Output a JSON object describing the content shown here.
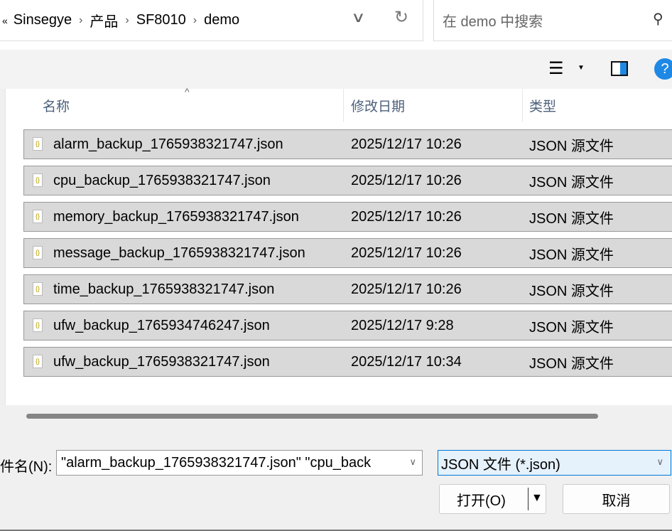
{
  "breadcrumb": {
    "overflow": "«",
    "items": [
      "Sinsegye",
      "产品",
      "SF8010",
      "demo"
    ]
  },
  "search": {
    "placeholder": "在 demo 中搜索"
  },
  "columns": {
    "name": "名称",
    "date": "修改日期",
    "type": "类型"
  },
  "files": [
    {
      "name": "alarm_backup_1765938321747.json",
      "date": "2025/12/17 10:26",
      "type": "JSON 源文件"
    },
    {
      "name": "cpu_backup_1765938321747.json",
      "date": "2025/12/17 10:26",
      "type": "JSON 源文件"
    },
    {
      "name": "memory_backup_1765938321747.json",
      "date": "2025/12/17 10:26",
      "type": "JSON 源文件"
    },
    {
      "name": "message_backup_1765938321747.json",
      "date": "2025/12/17 10:26",
      "type": "JSON 源文件"
    },
    {
      "name": "time_backup_1765938321747.json",
      "date": "2025/12/17 10:26",
      "type": "JSON 源文件"
    },
    {
      "name": "ufw_backup_1765934746247.json",
      "date": "2025/12/17 9:28",
      "type": "JSON 源文件"
    },
    {
      "name": "ufw_backup_1765938321747.json",
      "date": "2025/12/17 10:34",
      "type": "JSON 源文件"
    }
  ],
  "footer": {
    "filename_label": "件名(N):",
    "filename_value": "\"alarm_backup_1765938321747.json\" \"cpu_back",
    "filter": "JSON 文件 (*.json)",
    "open": "打开(O)",
    "cancel": "取消"
  }
}
